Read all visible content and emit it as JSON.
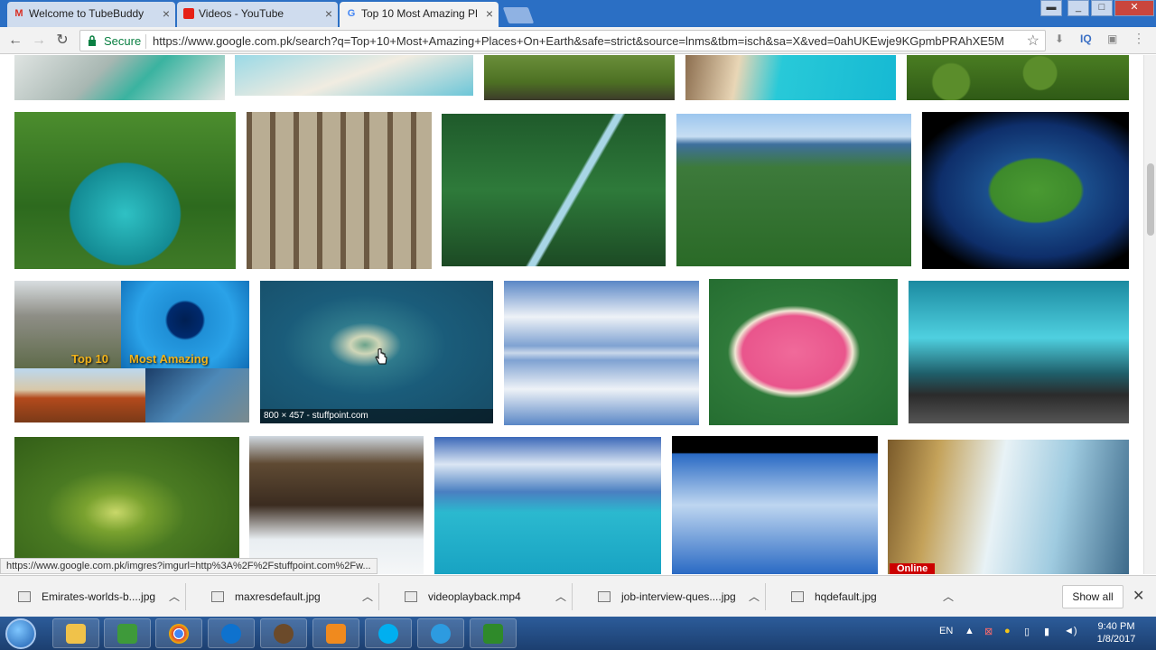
{
  "browser": {
    "tabs": [
      {
        "title": "Welcome to TubeBuddy",
        "favicon": "gmail-icon",
        "color": "#d93025"
      },
      {
        "title": "Videos - YouTube",
        "favicon": "youtube-icon",
        "color": "#e62117"
      },
      {
        "title": "Top 10 Most Amazing Pl",
        "favicon": "google-icon",
        "color": "#4285f4"
      }
    ],
    "secure_label": "Secure",
    "url": "https://www.google.com.pk/search?q=Top+10+Most+Amazing+Places+On+Earth&safe=strict&source=lnms&tbm=isch&sa=X&ved=0ahUKEwje9KGpmbPRAhXE5M",
    "ext_label": "IQ"
  },
  "results": {
    "collage_text_1": "Top 10",
    "collage_text_2": "Most Amazing",
    "hover_caption": "800 × 457 - stuffpoint.com",
    "online_badge": "Online"
  },
  "status_url": "https://www.google.com.pk/imgres?imgurl=http%3A%2F%2Fstuffpoint.com%2Fw...",
  "downloads": {
    "items": [
      {
        "name": "Emirates-worlds-b....jpg"
      },
      {
        "name": "maxresdefault.jpg"
      },
      {
        "name": "videoplayback.mp4"
      },
      {
        "name": "job-interview-ques....jpg"
      },
      {
        "name": "hqdefault.jpg"
      }
    ],
    "show_all": "Show all"
  },
  "taskbar": {
    "language": "EN",
    "time": "9:40 PM",
    "date": "1/8/2017"
  }
}
